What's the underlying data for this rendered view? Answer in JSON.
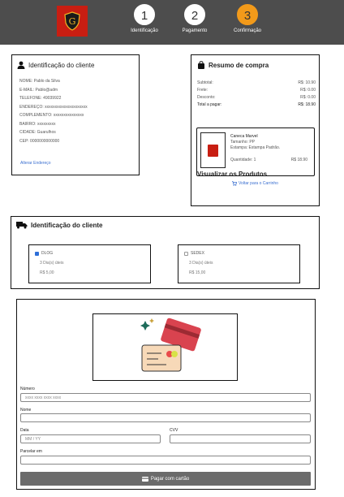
{
  "header": {
    "steps": [
      {
        "number": "1",
        "label": "Identificação"
      },
      {
        "number": "2",
        "label": "Pagamento"
      },
      {
        "number": "3",
        "label": "Confirmação",
        "active": true
      }
    ]
  },
  "client": {
    "title": "Identificação do cliente",
    "rows": [
      "NOME: Pablo da Silva",
      "E-MAIL: Pablo@adm",
      "TELEFONE: 49039922",
      "ENDEREÇO: xxxxxxxxxxxxxxxxxxxxx",
      "COMPLEMENTO: xxxxxxxxxxxxxxx",
      "BAIRRO: xxxxxxxxx",
      "CIDADE: Guarulhos",
      "CEP: 0000000000000"
    ],
    "alter_link": "Alterar Endereço"
  },
  "summary": {
    "title": "Resumo de compra",
    "rows": [
      {
        "label": "Subtotal:",
        "value": "R$: 10.90"
      },
      {
        "label": "Frete:",
        "value": "R$: 0.00"
      },
      {
        "label": "Desconto:",
        "value": "R$: 0.00"
      },
      {
        "label": "Total a pagar:",
        "value": "R$: 18.90"
      }
    ],
    "view_title": "Visualizar os Produtos",
    "product": {
      "name": "Caneca Marvel",
      "size": "Tamanho: PP",
      "print": "Estampa: Estampa Padrão.",
      "quantity": "Quantidade: 1",
      "price": "R$ 18.90"
    },
    "back_link": "Voltar para o Carrinho"
  },
  "shipping": {
    "title": "Identificação do cliente",
    "options": [
      {
        "name": "DLOG",
        "days": "3 Dia(s) úteis",
        "price": "R$ 5,00",
        "selected": true
      },
      {
        "name": "SEDEX",
        "days": "3 Dia(s) úteis",
        "price": "R$ 15,00",
        "selected": false
      }
    ]
  },
  "payment": {
    "number_label": "Número",
    "number_placeholder": "xxxx xxxx xxxx xxxx",
    "name_label": "Nome",
    "date_label": "Data",
    "date_placeholder": "MM / YY",
    "cvv_label": "CVV",
    "installments_label": "Parcelar em",
    "pay_button": "Pagar com cartão"
  }
}
